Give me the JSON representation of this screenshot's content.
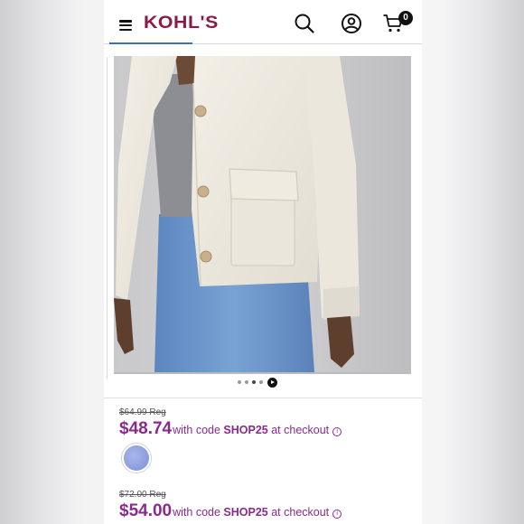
{
  "header": {
    "logo_text": "KOHL'S",
    "menu_icon": "hamburger-menu-icon",
    "search_icon": "search-icon",
    "account_icon": "user-account-icon",
    "cart_icon": "shopping-cart-icon",
    "cart_count": "0",
    "brand_color": "#8b1a49"
  },
  "gallery": {
    "image_description": "model-in-cream-cropped-jacket-gray-top-jeans",
    "dot_count": 4,
    "play_icon": "play-video-icon"
  },
  "offers": [
    {
      "regular_price": "$64.99 Reg",
      "sale_price": "$48.74",
      "code_prefix": "with code ",
      "promo_code": "SHOP25",
      "code_suffix": " at checkout",
      "info_icon": "info-icon"
    },
    {
      "regular_price": "$72.00 Reg",
      "sale_price": "$54.00",
      "code_prefix": "with code ",
      "promo_code": "SHOP25",
      "code_suffix": " at checkout",
      "info_icon": "info-icon"
    }
  ],
  "swatch": {
    "name": "light-blue-color-swatch",
    "color": "#8d9fe0"
  },
  "colors": {
    "sale_purple": "#8a2a8e",
    "logo_maroon": "#8b1a49"
  }
}
